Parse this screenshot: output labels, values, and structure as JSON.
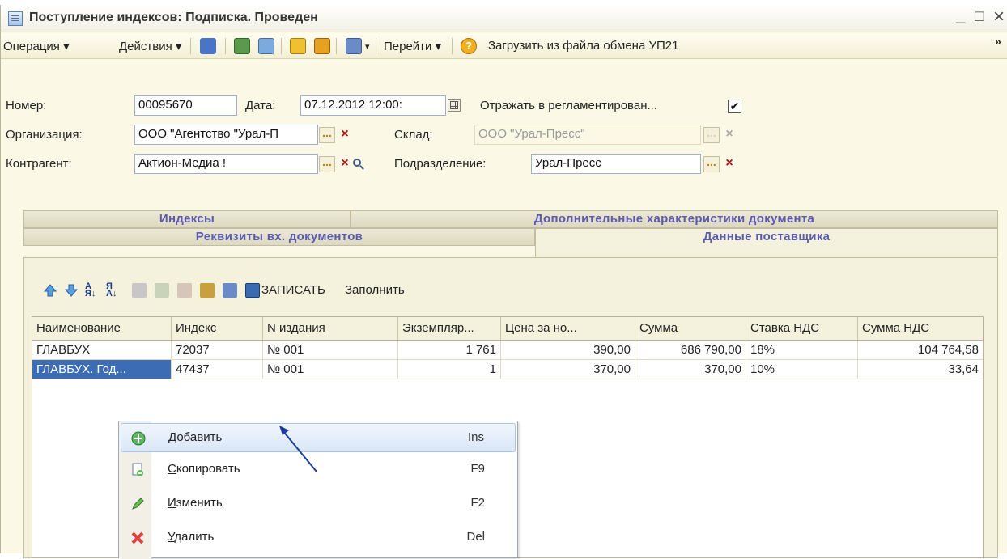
{
  "window": {
    "title": "Поступление индексов: Подписка. Проведен",
    "controls": {
      "minimize": "_",
      "maximize": "□",
      "close": "×"
    }
  },
  "toolbar": {
    "operation": "Операция ▾",
    "actions": "Действия ▾",
    "goto": "Перейти ▾",
    "load": "Загрузить из файла обмена УП21",
    "overflow": "»"
  },
  "form": {
    "number_label": "Номер:",
    "number_value": "00095670",
    "date_label": "Дата:",
    "date_value": "07.12.2012 12:00:",
    "reflect_label": "Отражать в регламентирован...",
    "reflect_checked": "✔",
    "org_label": "Организация:",
    "org_value": "ООО \"Агентство \"Урал-П",
    "warehouse_label": "Склад:",
    "warehouse_value": "ООО \"Урал-Пресс\"",
    "counterparty_label": "Контрагент:",
    "counterparty_value": "Актион-Медиа  !",
    "division_label": "Подразделение:",
    "division_value": "Урал-Пресс",
    "dots": "...",
    "clear": "×",
    "search_glyph": "🔍"
  },
  "tabs": [
    {
      "label": "Индексы",
      "active": false
    },
    {
      "label": "Дополнительные характеристики документа",
      "active": false
    },
    {
      "label": "Реквизиты вх. документов",
      "active": false
    },
    {
      "label": "Данные поставщика",
      "active": true
    }
  ],
  "inner_toolbar": {
    "write": "ЗАПИСАТЬ",
    "fill": "Заполнить"
  },
  "table": {
    "columns": [
      "Наименование",
      "Индекс",
      "N издания",
      "Экземпляр...",
      "Цена за но...",
      "Сумма",
      "Ставка НДС",
      "Сумма НДС"
    ],
    "rows": [
      [
        "ГЛАВБУХ",
        "72037",
        "№ 001",
        "1 761",
        "390,00",
        "686 790,00",
        "18%",
        "104 764,58"
      ],
      [
        "ГЛАВБУХ. Год...",
        "47437",
        "№ 001",
        "1",
        "370,00",
        "370,00",
        "10%",
        "33,64"
      ]
    ]
  },
  "context_menu": [
    {
      "label_u": "Д",
      "label_rest": "обавить",
      "shortcut": "Ins",
      "icon": "add-icon",
      "highlighted": true
    },
    {
      "label_u": "С",
      "label_rest": "копировать",
      "shortcut": "F9",
      "icon": "copy-icon",
      "highlighted": false
    },
    {
      "label_u": "И",
      "label_rest": "зменить",
      "shortcut": "F2",
      "icon": "edit-icon",
      "highlighted": false
    },
    {
      "label_u": "У",
      "label_rest": "далить",
      "shortcut": "Del",
      "icon": "delete-icon",
      "highlighted": false
    }
  ],
  "colors": {
    "window_bg": "#fbf8e6",
    "tab_text": "#5a5ab0",
    "selection": "#3c6cb4",
    "arrow": "#1c3c9c"
  }
}
